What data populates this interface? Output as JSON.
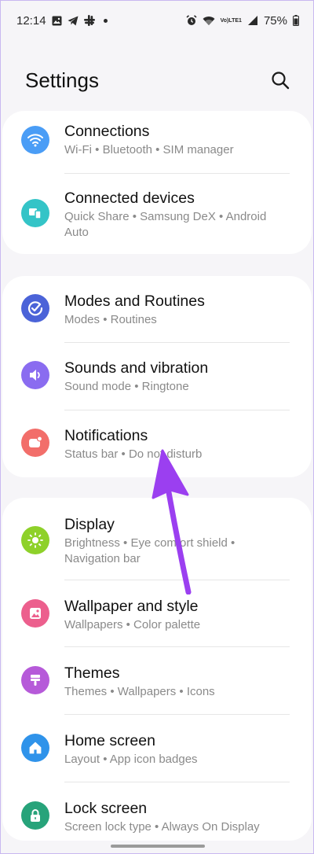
{
  "status_bar": {
    "time": "12:14",
    "lte_top": "Vo)",
    "lte_bottom": "LTE1",
    "battery": "75%"
  },
  "header": {
    "title": "Settings"
  },
  "groups": [
    {
      "items": [
        {
          "title": "Connections",
          "subtitle": "Wi-Fi  •  Bluetooth  •  SIM manager",
          "icon": "wifi-icon",
          "color": "#4a9df6"
        },
        {
          "title": "Connected devices",
          "subtitle": "Quick Share  •  Samsung DeX  •  Android Auto",
          "icon": "devices-icon",
          "color": "#34c4c7"
        }
      ]
    },
    {
      "items": [
        {
          "title": "Modes and Routines",
          "subtitle": "Modes  •  Routines",
          "icon": "check-circle-icon",
          "color": "#4b63d8"
        },
        {
          "title": "Sounds and vibration",
          "subtitle": "Sound mode  •  Ringtone",
          "icon": "speaker-icon",
          "color": "#8a6cf0"
        },
        {
          "title": "Notifications",
          "subtitle": "Status bar  •  Do not disturb",
          "icon": "notification-icon",
          "color": "#f26e6a"
        }
      ]
    },
    {
      "items": [
        {
          "title": "Display",
          "subtitle": "Brightness  •  Eye comfort shield  •  Navigation bar",
          "icon": "sun-icon",
          "color": "#8ed12a"
        },
        {
          "title": "Wallpaper and style",
          "subtitle": "Wallpapers  •  Color palette",
          "icon": "image-icon",
          "color": "#ec5f8d"
        },
        {
          "title": "Themes",
          "subtitle": "Themes  •  Wallpapers  •  Icons",
          "icon": "brush-icon",
          "color": "#b65ad9"
        },
        {
          "title": "Home screen",
          "subtitle": "Layout  •  App icon badges",
          "icon": "home-icon",
          "color": "#2f93ea"
        },
        {
          "title": "Lock screen",
          "subtitle": "Screen lock type  •  Always On Display",
          "icon": "lock-icon",
          "color": "#27a37a"
        }
      ]
    }
  ],
  "colors": {
    "background": "#f6f5f8",
    "card": "#ffffff",
    "annotation_arrow": "#9b3ff0"
  }
}
